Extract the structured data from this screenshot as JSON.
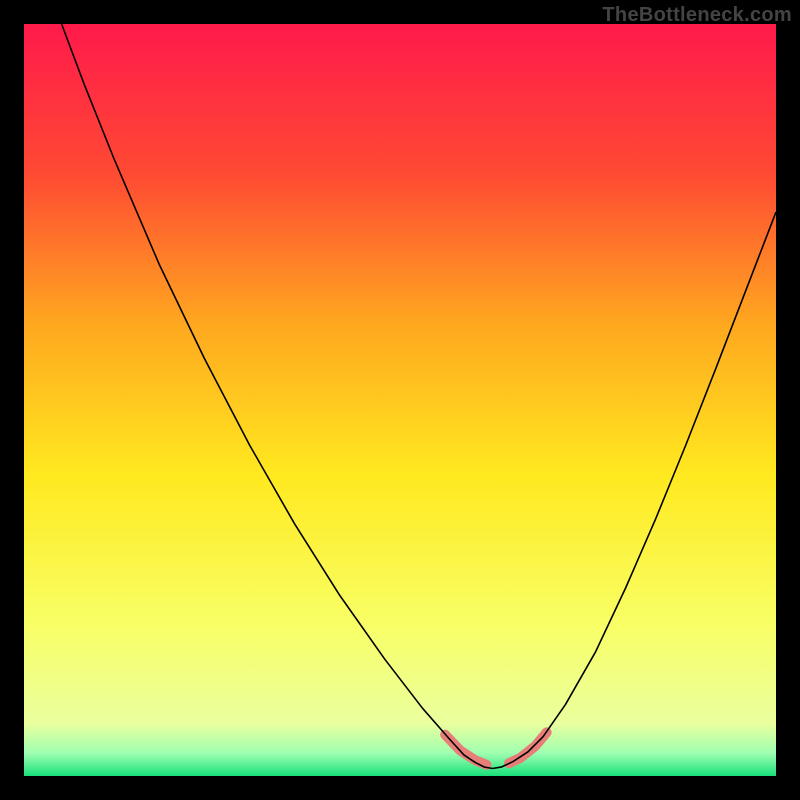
{
  "attribution": "TheBottleneck.com",
  "chart_data": {
    "type": "line",
    "title": "",
    "xlabel": "",
    "ylabel": "",
    "xlim": [
      0,
      100
    ],
    "ylim": [
      0,
      100
    ],
    "grid": false,
    "legend": false,
    "background_gradient_stops": [
      {
        "offset": 0.0,
        "color": "#ff1a4b"
      },
      {
        "offset": 0.2,
        "color": "#ff4a33"
      },
      {
        "offset": 0.4,
        "color": "#ffa81f"
      },
      {
        "offset": 0.6,
        "color": "#ffe91f"
      },
      {
        "offset": 0.8,
        "color": "#f8ff66"
      },
      {
        "offset": 0.93,
        "color": "#eaff9e"
      },
      {
        "offset": 0.97,
        "color": "#9dffb0"
      },
      {
        "offset": 1.0,
        "color": "#18e07a"
      }
    ],
    "series": [
      {
        "name": "left-branch",
        "stroke": "#000000",
        "stroke_width": 1.6,
        "points": [
          {
            "x": 5.0,
            "y": 100.0
          },
          {
            "x": 8.0,
            "y": 92.0
          },
          {
            "x": 12.0,
            "y": 82.0
          },
          {
            "x": 18.0,
            "y": 68.0
          },
          {
            "x": 24.0,
            "y": 55.5
          },
          {
            "x": 30.0,
            "y": 44.0
          },
          {
            "x": 36.0,
            "y": 33.5
          },
          {
            "x": 42.0,
            "y": 24.0
          },
          {
            "x": 48.0,
            "y": 15.5
          },
          {
            "x": 53.0,
            "y": 9.0
          },
          {
            "x": 56.5,
            "y": 5.0
          },
          {
            "x": 58.5,
            "y": 2.8
          },
          {
            "x": 60.0,
            "y": 1.8
          },
          {
            "x": 61.2,
            "y": 1.2
          },
          {
            "x": 62.3,
            "y": 1.0
          }
        ]
      },
      {
        "name": "right-branch",
        "stroke": "#000000",
        "stroke_width": 1.6,
        "points": [
          {
            "x": 62.3,
            "y": 1.0
          },
          {
            "x": 63.5,
            "y": 1.2
          },
          {
            "x": 65.0,
            "y": 1.9
          },
          {
            "x": 67.0,
            "y": 3.2
          },
          {
            "x": 69.0,
            "y": 5.2
          },
          {
            "x": 72.0,
            "y": 9.5
          },
          {
            "x": 76.0,
            "y": 16.5
          },
          {
            "x": 80.0,
            "y": 25.0
          },
          {
            "x": 84.0,
            "y": 34.2
          },
          {
            "x": 88.0,
            "y": 44.0
          },
          {
            "x": 92.0,
            "y": 54.2
          },
          {
            "x": 96.0,
            "y": 64.6
          },
          {
            "x": 100.0,
            "y": 75.0
          }
        ]
      },
      {
        "name": "highlight-left",
        "stroke": "#e77f78",
        "stroke_width": 10,
        "linecap": "round",
        "points": [
          {
            "x": 56.0,
            "y": 5.5
          },
          {
            "x": 58.0,
            "y": 3.4
          },
          {
            "x": 60.0,
            "y": 2.1
          },
          {
            "x": 61.5,
            "y": 1.5
          }
        ]
      },
      {
        "name": "highlight-right",
        "stroke": "#e77f78",
        "stroke_width": 10,
        "linecap": "round",
        "points": [
          {
            "x": 64.5,
            "y": 1.7
          },
          {
            "x": 66.0,
            "y": 2.4
          },
          {
            "x": 68.0,
            "y": 4.0
          },
          {
            "x": 69.5,
            "y": 5.8
          }
        ]
      }
    ]
  }
}
